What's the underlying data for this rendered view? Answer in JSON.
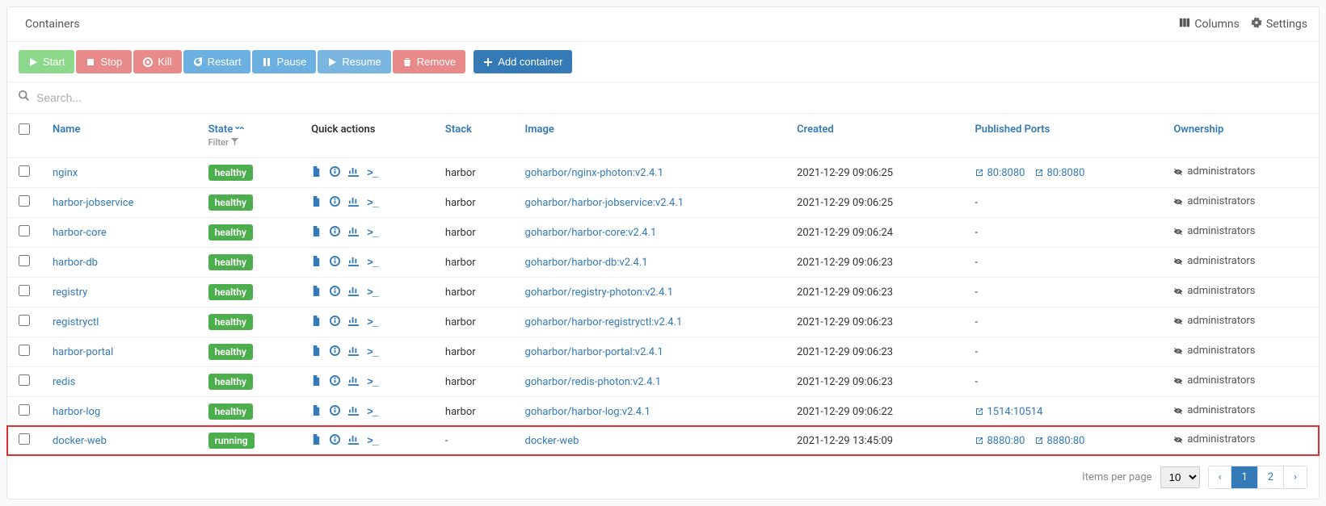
{
  "header": {
    "title": "Containers",
    "columns": "Columns",
    "settings": "Settings"
  },
  "toolbar": {
    "start": "Start",
    "stop": "Stop",
    "kill": "Kill",
    "restart": "Restart",
    "pause": "Pause",
    "resume": "Resume",
    "remove": "Remove",
    "add": "Add container"
  },
  "search": {
    "placeholder": "Search..."
  },
  "columns": {
    "name": "Name",
    "state": "State",
    "filter": "Filter",
    "quick": "Quick actions",
    "stack": "Stack",
    "image": "Image",
    "created": "Created",
    "ports": "Published Ports",
    "ownership": "Ownership"
  },
  "rows": [
    {
      "name": "nginx",
      "state": "healthy",
      "stack": "harbor",
      "image": "goharbor/nginx-photon:v2.4.1",
      "created": "2021-12-29 09:06:25",
      "ports": [
        "80:8080",
        "80:8080"
      ],
      "owner": "administrators"
    },
    {
      "name": "harbor-jobservice",
      "state": "healthy",
      "stack": "harbor",
      "image": "goharbor/harbor-jobservice:v2.4.1",
      "created": "2021-12-29 09:06:25",
      "ports": [],
      "owner": "administrators"
    },
    {
      "name": "harbor-core",
      "state": "healthy",
      "stack": "harbor",
      "image": "goharbor/harbor-core:v2.4.1",
      "created": "2021-12-29 09:06:24",
      "ports": [],
      "owner": "administrators"
    },
    {
      "name": "harbor-db",
      "state": "healthy",
      "stack": "harbor",
      "image": "goharbor/harbor-db:v2.4.1",
      "created": "2021-12-29 09:06:23",
      "ports": [],
      "owner": "administrators"
    },
    {
      "name": "registry",
      "state": "healthy",
      "stack": "harbor",
      "image": "goharbor/registry-photon:v2.4.1",
      "created": "2021-12-29 09:06:23",
      "ports": [],
      "owner": "administrators"
    },
    {
      "name": "registryctl",
      "state": "healthy",
      "stack": "harbor",
      "image": "goharbor/harbor-registryctl:v2.4.1",
      "created": "2021-12-29 09:06:23",
      "ports": [],
      "owner": "administrators"
    },
    {
      "name": "harbor-portal",
      "state": "healthy",
      "stack": "harbor",
      "image": "goharbor/harbor-portal:v2.4.1",
      "created": "2021-12-29 09:06:23",
      "ports": [],
      "owner": "administrators"
    },
    {
      "name": "redis",
      "state": "healthy",
      "stack": "harbor",
      "image": "goharbor/redis-photon:v2.4.1",
      "created": "2021-12-29 09:06:23",
      "ports": [],
      "owner": "administrators"
    },
    {
      "name": "harbor-log",
      "state": "healthy",
      "stack": "harbor",
      "image": "goharbor/harbor-log:v2.4.1",
      "created": "2021-12-29 09:06:22",
      "ports": [
        "1514:10514"
      ],
      "owner": "administrators"
    },
    {
      "name": "docker-web",
      "state": "running",
      "stack": "-",
      "image": "docker-web",
      "created": "2021-12-29 13:45:09",
      "ports": [
        "8880:80",
        "8880:80"
      ],
      "owner": "administrators",
      "highlight": true
    }
  ],
  "footer": {
    "label": "Items per page",
    "value": "10",
    "pages": [
      "1",
      "2"
    ],
    "active": "1"
  }
}
